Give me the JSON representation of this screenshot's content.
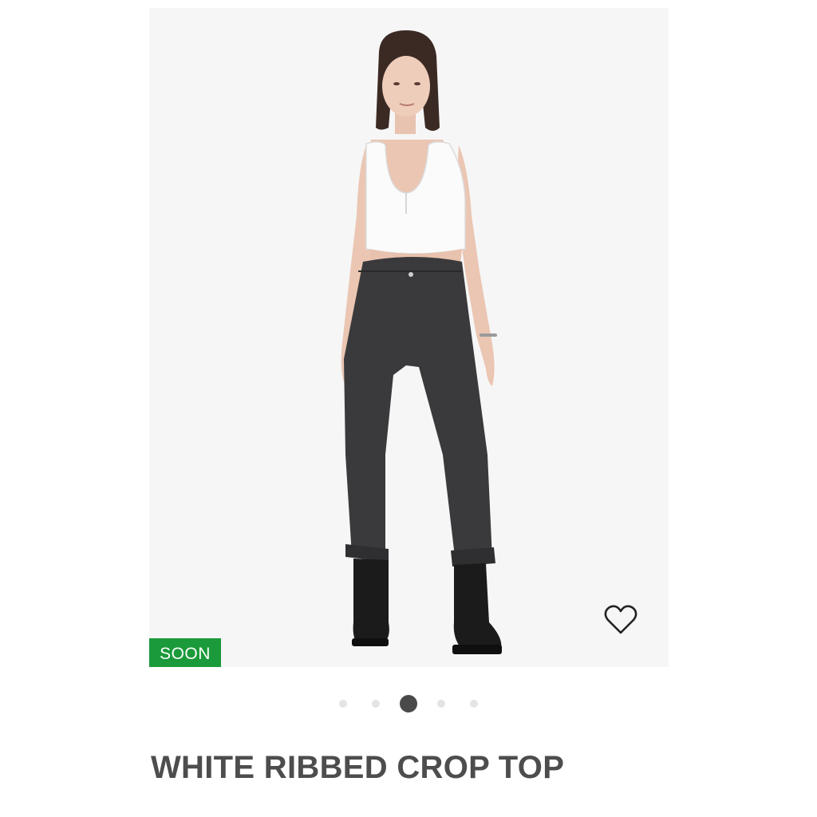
{
  "product": {
    "title": "WHITE RIBBED CROP TOP",
    "badge": "SOON",
    "image_alt": "Model wearing white ribbed crop top with black jeans and black boots"
  },
  "wishlist": {
    "icon": "heart-outline-icon"
  },
  "carousel": {
    "total": 5,
    "active_index": 2
  },
  "colors": {
    "badge_bg": "#1a9a3a",
    "title": "#4d4d4d",
    "dot_active": "#4a4a4a",
    "dot_inactive": "#e4e4e4",
    "image_bg": "#f6f6f6"
  }
}
